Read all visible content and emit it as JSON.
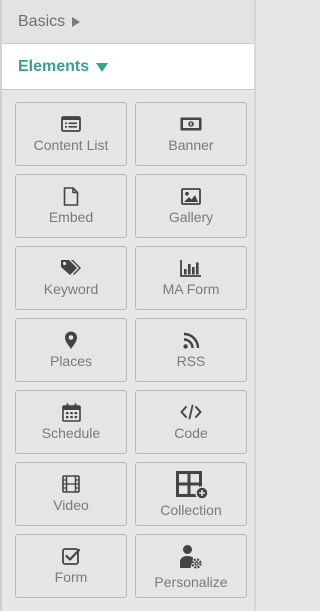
{
  "sections": {
    "basics": {
      "label": "Basics"
    },
    "elements": {
      "label": "Elements"
    }
  },
  "tiles": [
    {
      "label": "Content List",
      "icon": "content-list-icon"
    },
    {
      "label": "Banner",
      "icon": "banner-icon"
    },
    {
      "label": "Embed",
      "icon": "embed-document-icon"
    },
    {
      "label": "Gallery",
      "icon": "gallery-image-icon"
    },
    {
      "label": "Keyword",
      "icon": "tags-icon"
    },
    {
      "label": "MA Form",
      "icon": "bar-chart-icon"
    },
    {
      "label": "Places",
      "icon": "map-pin-icon"
    },
    {
      "label": "RSS",
      "icon": "rss-icon"
    },
    {
      "label": "Schedule",
      "icon": "calendar-icon"
    },
    {
      "label": "Code",
      "icon": "code-icon"
    },
    {
      "label": "Video",
      "icon": "film-icon"
    },
    {
      "label": "Collection",
      "icon": "collection-add-icon"
    },
    {
      "label": "Form",
      "icon": "checkbox-form-icon"
    },
    {
      "label": "Personalize",
      "icon": "user-gear-icon"
    }
  ],
  "colors": {
    "accent": "#35a38a",
    "tile_text": "#7a7a7a",
    "icon": "#444444"
  }
}
